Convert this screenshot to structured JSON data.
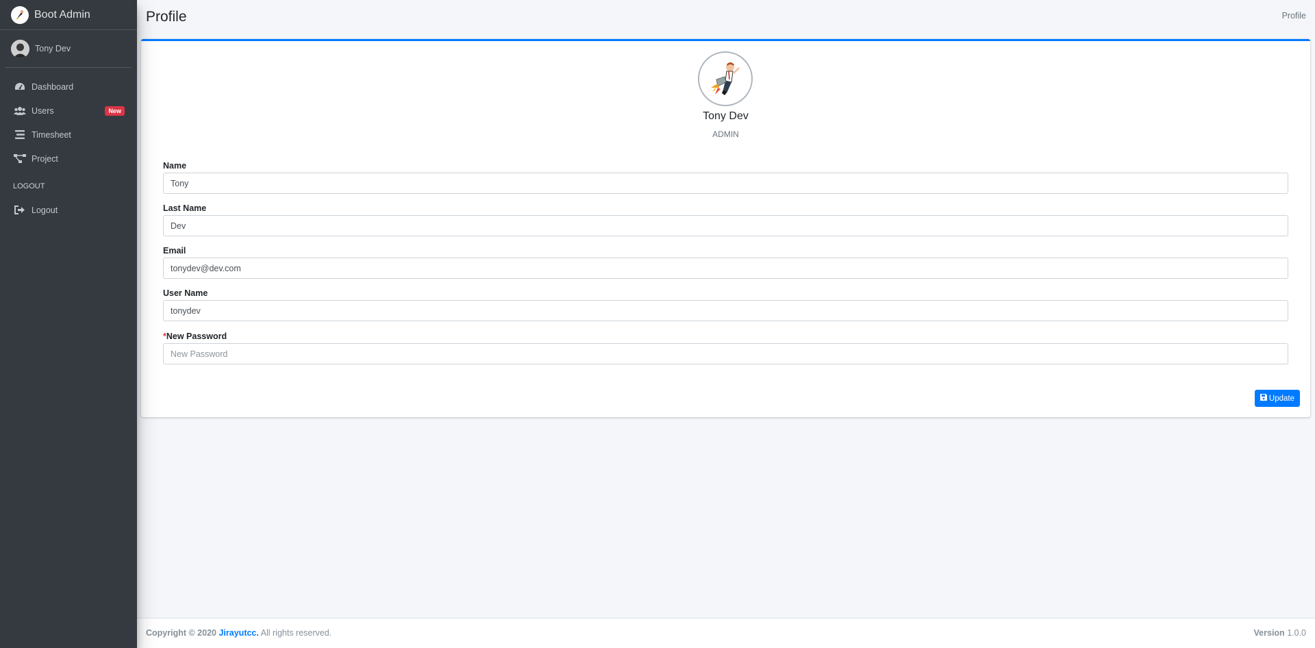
{
  "sidebar": {
    "brand": "Boot Admin",
    "user_name": "Tony Dev",
    "items": [
      {
        "label": "Dashboard",
        "icon": "dashboard-icon"
      },
      {
        "label": "Users",
        "icon": "users-icon",
        "badge": "New"
      },
      {
        "label": "Timesheet",
        "icon": "list-icon"
      },
      {
        "label": "Project",
        "icon": "project-diagram-icon"
      }
    ],
    "section_header": "LOGOUT",
    "logout_label": "Logout"
  },
  "header": {
    "title": "Profile",
    "breadcrumb": "Profile"
  },
  "profile": {
    "name": "Tony Dev",
    "role": "ADMIN"
  },
  "form": {
    "name": {
      "label": "Name",
      "value": "Tony"
    },
    "last_name": {
      "label": "Last Name",
      "value": "Dev"
    },
    "email": {
      "label": "Email",
      "value": "tonydev@dev.com"
    },
    "username": {
      "label": "User Name",
      "value": "tonydev"
    },
    "password": {
      "required_mark": "*",
      "label": "New Password",
      "placeholder": "New Password"
    },
    "update_label": "Update"
  },
  "footer": {
    "copyright": "Copyright © 2020",
    "company": "Jirayutcc.",
    "rights": "All rights reserved.",
    "version_label": "Version",
    "version": "1.0.0"
  },
  "colors": {
    "sidebar_bg": "#343a40",
    "primary": "#007bff",
    "badge_red": "#dc3545",
    "content_bg": "#f4f6f9"
  }
}
